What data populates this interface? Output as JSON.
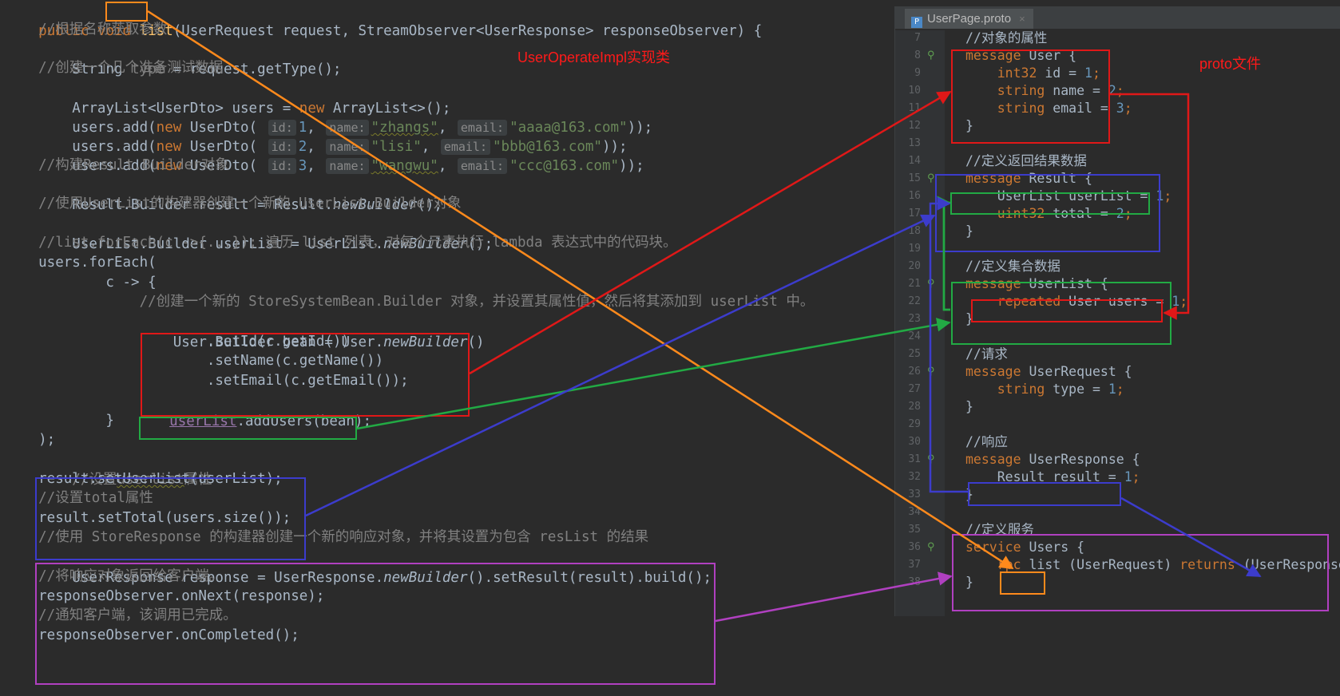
{
  "java": {
    "l0": {
      "a": "public void ",
      "b": "list",
      "c": "(UserRequest request, StreamObserver<UserResponse> responseObserver) {"
    },
    "l1": "    //根据名称获取参数",
    "l2": {
      "a": "    String ",
      "b": "type",
      "c": " = request.getType();"
    },
    "l3": "    //创建一个几个准备测试数据",
    "l4": {
      "a": "    ArrayList<UserDto> users = ",
      "b": "new",
      "c": " ArrayList<>();"
    },
    "l5": {
      "a": "    users.add(",
      "kw": "new",
      "b": " UserDto( ",
      "h1": "id:",
      "v1": "1",
      "s1": ", ",
      "h2": "name:",
      "v2": "\"zhangs\"",
      "s2": ", ",
      "h3": "email:",
      "v3": "\"aaaa@163.com\"",
      "e": "));"
    },
    "l6": {
      "a": "    users.add(",
      "kw": "new",
      "b": " UserDto( ",
      "h1": "id:",
      "v1": "2",
      "s1": ", ",
      "h2": "name:",
      "v2": "\"lisi\"",
      "s2": ", ",
      "h3": "email:",
      "v3": "\"bbb@163.com\"",
      "e": "));"
    },
    "l7": {
      "a": "    users.add(",
      "kw": "new",
      "b": " UserDto( ",
      "h1": "id:",
      "v1": "3",
      "s1": ", ",
      "h2": "name:",
      "v2": "\"wangwu\"",
      "s2": ", ",
      "h3": "email:",
      "v3": "\"ccc@163.com\"",
      "e": "));"
    },
    "l8": "    //构建Result.Builder对象",
    "l9": {
      "a": "    Result.Builder result = Result.",
      "b": "newBuilder",
      "c": "();"
    },
    "l10": "    //使用UserList的构建器创建一个新的 UserList.Builder对象",
    "l11": {
      "a": "    UserList.Builder userList = UserList.",
      "b": "newBuilder",
      "c": "();"
    },
    "l12": "    //list.forEach(c ->{...}); 遍历 list 列表，对每个元素执行 lambda 表达式中的代码块。",
    "l13": "    users.forEach(",
    "l14": "            c -> {",
    "l15": "                //创建一个新的 StoreSystemBean.Builder 对象，并设置其属性值，然后将其添加到 userList 中。",
    "l16": {
      "a": "                User.Builder bean = User.",
      "b": "newBuilder",
      "c": "()"
    },
    "l17": "                        .setId(c.getId())",
    "l18": "                        .setName(c.getName())",
    "l19": "                        .setEmail(c.getEmail());",
    "l20": {
      "a": "userList",
      "b": ".addUsers(bean);"
    },
    "l21": "            }",
    "l22": "    );",
    "l23": {
      "a": "    //设置",
      "b": "userlist",
      "c": "属性"
    },
    "l24": "    result.setUserList(userList);",
    "l25": "    //设置total属性",
    "l26": "    result.setTotal(users.size());",
    "l27": "    //使用 StoreResponse 的构建器创建一个新的响应对象，并将其设置为包含 resList 的结果",
    "l28": {
      "a": "    UserResponse response = UserResponse.",
      "b": "newBuilder",
      "c": "().setResult(result).build();"
    },
    "l29": "    //将响应对象返回给客户端。",
    "l30": "    responseObserver.onNext(response);",
    "l31": "    //通知客户端，该调用已完成。",
    "l32": "    responseObserver.onCompleted();"
  },
  "proto": {
    "tab": "UserPage.proto",
    "tab_close": "×",
    "file_icon": "P",
    "line_numbers": [
      "7",
      "8",
      "9",
      "10",
      "11",
      "12",
      "13",
      "14",
      "15",
      "16",
      "17",
      "18",
      "19",
      "20",
      "21",
      "22",
      "23",
      "24",
      "25",
      "26",
      "27",
      "28",
      "29",
      "30",
      "31",
      "32",
      "33",
      "34",
      "35",
      "36",
      "37",
      "38"
    ],
    "p7": "//对象的属性",
    "p8": {
      "kw": "message",
      "b": " User {"
    },
    "p9": {
      "kw": "    int32",
      "b": " id = ",
      "n": "1",
      "e": ";"
    },
    "p10": {
      "kw": "    string",
      "b": " name = ",
      "n": "2",
      "e": ";"
    },
    "p11": {
      "kw": "    string",
      "b": " email = ",
      "n": "3",
      "e": ";"
    },
    "p12": "}",
    "p14": "//定义返回结果数据",
    "p15": {
      "kw": "message",
      "b": " Result {"
    },
    "p16": {
      "b": "    UserList userList = ",
      "n": "1",
      "e": ";"
    },
    "p17": {
      "kw": "    uint32",
      "b": " total = ",
      "n": "2",
      "e": ";"
    },
    "p18": "}",
    "p20": "//定义集合数据",
    "p21": {
      "kw": "message",
      "b": " UserList {"
    },
    "p22": {
      "kw": "    repeated",
      "b": " User users = ",
      "n": "1",
      "e": ";"
    },
    "p23": "}",
    "p25": "//请求",
    "p26": {
      "kw": "message",
      "b": " UserRequest {"
    },
    "p27": {
      "kw": "    string",
      "b": " type = ",
      "n": "1",
      "e": ";"
    },
    "p28": "}",
    "p30": "//响应",
    "p31": {
      "kw": "message",
      "b": " UserResponse {"
    },
    "p32": {
      "b": "    Result result = ",
      "n": "1",
      "e": ";"
    },
    "p33": "}",
    "p35": "//定义服务",
    "p36": {
      "kw": "service",
      "b": " Users {"
    },
    "p37": {
      "kw": "    rpc",
      "sp": " ",
      "m": "list",
      "b": " (UserRequest) ",
      "kw2": "returns",
      "c": " (UserResponse);"
    },
    "p38": "}"
  },
  "annotations": {
    "impl_label": "UserOperateImpl实现类",
    "proto_label": "proto文件"
  },
  "colors": {
    "red": "#e01818",
    "blue": "#3c3ccc",
    "green": "#22aa44",
    "orange": "#ff8a1c",
    "purple": "#b040c0"
  }
}
